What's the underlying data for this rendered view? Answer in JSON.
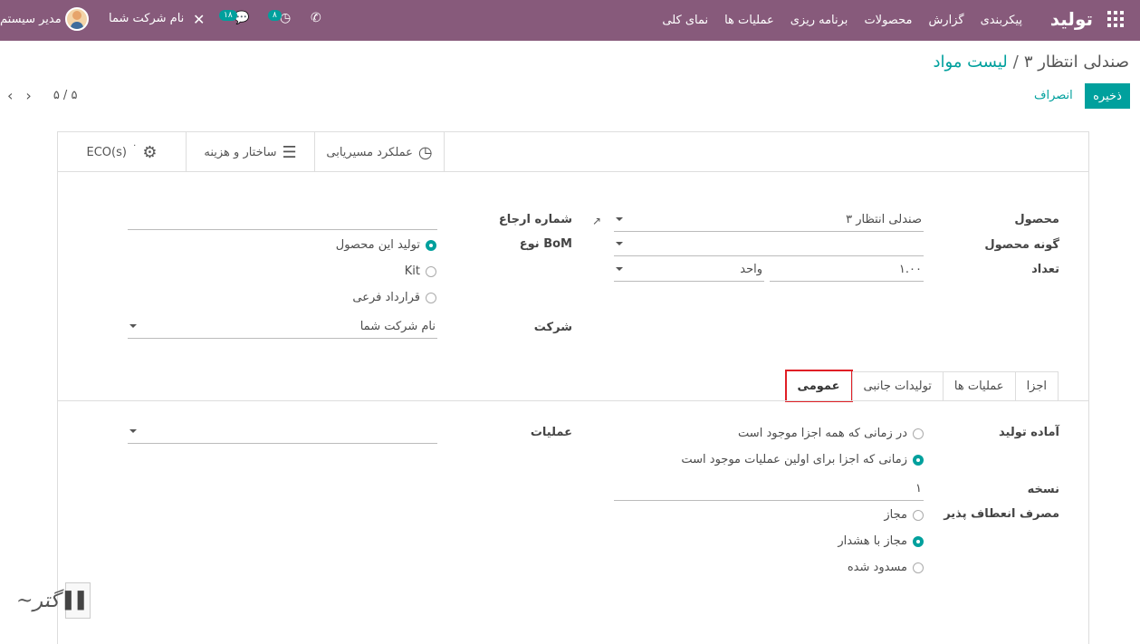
{
  "navbar": {
    "brand": "تولید",
    "menu": [
      "نمای کلی",
      "عملیات ها",
      "برنامه ریزی",
      "محصولات",
      "گزارش",
      "پیکربندی"
    ],
    "user": "مدیر سیستم",
    "company": "نام شرکت شما",
    "messages_count": "۱۸",
    "activities_count": "۸",
    "color": "#875a7b"
  },
  "breadcrumb": {
    "parent": "لیست مواد",
    "separator": "/",
    "current": "صندلی انتظار ۳"
  },
  "actions": {
    "save": "ذخیره",
    "cancel": "انصراف"
  },
  "pager": {
    "value": "۵ / ۵"
  },
  "smart_buttons": {
    "routing": "عملکرد مسیریابی",
    "structure": "ساختار و هزینه",
    "eco": "ECO(s)",
    "eco_count": "۰"
  },
  "form": {
    "product_label": "محصول",
    "product_value": "صندلی انتظار ۳",
    "variant_label": "گونه محصول",
    "variant_value": "",
    "quantity_label": "تعداد",
    "quantity_value": "۱.۰۰",
    "uom_value": "واحد",
    "reference_label": "شماره ارجاع",
    "reference_value": "",
    "bom_type_label": "نوع BoM",
    "bom_types": [
      "تولید این محصول",
      "Kit",
      "قرارداد فرعی"
    ],
    "bom_type_selected": 0,
    "company_label": "شرکت",
    "company_value": "نام شرکت شما"
  },
  "tabs": [
    "اجزا",
    "عملیات ها",
    "تولیدات جانبی",
    "عمومی"
  ],
  "active_tab": "عمومی",
  "general": {
    "ready_label": "آماده تولید",
    "ready_options": [
      "در زمانی که همه اجزا موجود است",
      "زمانی که اجزا برای اولین عملیات موجود است"
    ],
    "ready_selected": 1,
    "version_label": "نسخه",
    "version_value": "۱",
    "flex_label": "مصرف انعطاف پذیر",
    "flex_options": [
      "مجاز",
      "مجاز با هشدار",
      "مسدود شده"
    ],
    "flex_selected": 1,
    "operation_label": "عملیات",
    "operation_value": ""
  },
  "accent_color": "#00a09d"
}
